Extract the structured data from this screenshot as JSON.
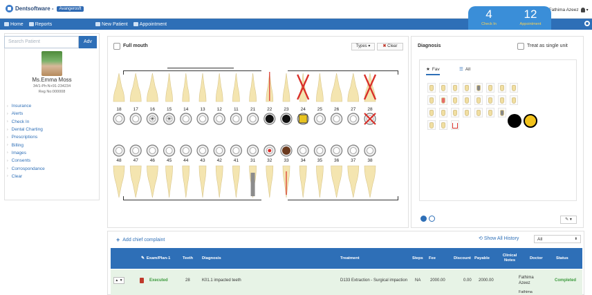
{
  "app": {
    "title": "Dentsoftware -",
    "org": "Avangerosft"
  },
  "nav": {
    "home": "Home",
    "reports": "Reports",
    "new_patient": "New Patient",
    "appointment": "Appointment"
  },
  "counters": [
    {
      "value": "4",
      "label": "Check In"
    },
    {
      "value": "12",
      "label": "Appointment"
    }
  ],
  "user": {
    "name": "Dr Fathima Azeez"
  },
  "patient_panel": {
    "search_placeholder": "Search Patient",
    "adv_label": "Adv",
    "name": "Ms.Emma Moss",
    "phone": "34/1-Ph:N+91-234234",
    "reg": "Reg No:000008",
    "menu": [
      "Insurance",
      "Alerts",
      "Check In",
      "Dental Charting",
      "Prescriptions",
      "Billing",
      "Images",
      "Consents",
      "Corrospondance",
      "Clear"
    ]
  },
  "chart": {
    "full_mouth_label": "Full mouth",
    "types_label": "Types ▾",
    "clear_label": "Clear",
    "upper_numbers": [
      "18",
      "17",
      "16",
      "15",
      "14",
      "13",
      "12",
      "11",
      "21",
      "22",
      "23",
      "24",
      "25",
      "26",
      "27",
      "28"
    ],
    "lower_numbers": [
      "48",
      "47",
      "46",
      "45",
      "44",
      "43",
      "42",
      "41",
      "31",
      "32",
      "33",
      "34",
      "35",
      "36",
      "37",
      "38"
    ]
  },
  "diagnosis": {
    "title": "Diagnosis",
    "treat_single_label": "Treat as single unit",
    "tab_fav": "Fav",
    "tab_all": "All"
  },
  "treatment": {
    "add_complaint": "Add chief complaint",
    "show_history": "Show All History",
    "filter_value": "All",
    "columns": [
      "Exam/Plan-1",
      "Teeth",
      "Diagnosis",
      "Treatment",
      "Steps",
      "Fee",
      "Discount",
      "Payable",
      "Clinical Notes",
      "Doctor",
      "Status"
    ],
    "rows": [
      {
        "status_flag": "Executed",
        "teeth": "28",
        "diagnosis": "K01.1 impacted teeth",
        "treatment": "D133 Extraction - Surgical impaction",
        "steps": "NA",
        "fee": "2000.00",
        "discount": "0.00",
        "payable": "2000.00",
        "notes": "",
        "doctor": "Fathima Azeez",
        "status": "Completed"
      }
    ],
    "next_row_doctor": "Fathima"
  },
  "colors": {
    "primary": "#2e6fb7",
    "counter": "#3a8ed8",
    "completed": "#3c9a3c",
    "executed": "#3c9a3c",
    "extract": "#d9302a"
  }
}
